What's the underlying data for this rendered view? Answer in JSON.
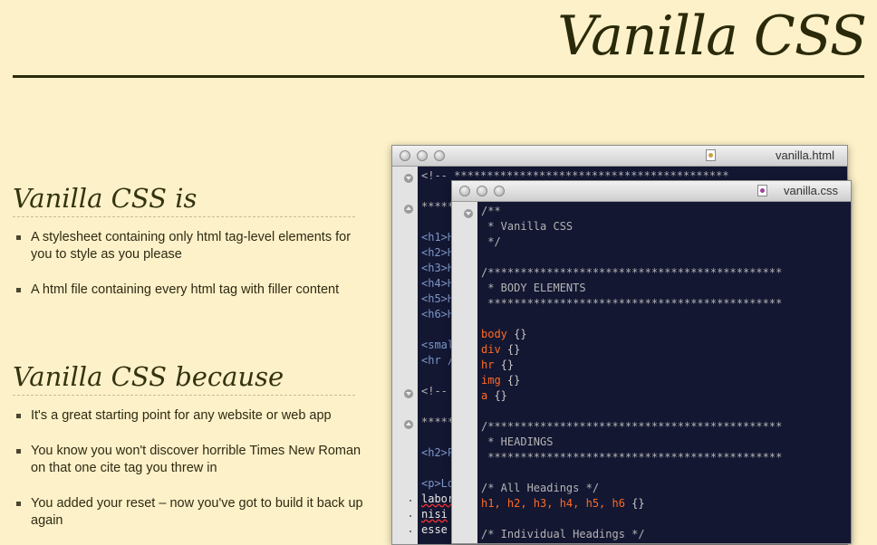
{
  "header": {
    "site_title": "Vanilla CSS"
  },
  "sections": [
    {
      "heading": "Vanilla CSS is",
      "items": [
        "A stylesheet containing only html tag-level elements for you to style as you please",
        "A html file containing every html tag with filler content"
      ]
    },
    {
      "heading": "Vanilla CSS because",
      "items": [
        "It's a great starting point for any website or web app",
        "You know you won't discover horrible Times New Roman on that one cite tag you threw in",
        "You added your reset – now you've got to build it back up again"
      ]
    }
  ],
  "html_window": {
    "title": "vanilla.html",
    "lines": [
      "<!-- ******************************************",
      "",
      "*****",
      "",
      "<h1>H",
      "<h2>H",
      "<h3>H",
      "<h4>H",
      "<h5>H",
      "<h6>H",
      "",
      "<smal",
      "<hr /",
      "",
      "<!--",
      "",
      "*****",
      "",
      "<h2>P",
      "",
      "<p>Lo",
      "labor",
      "nisi",
      "esse"
    ]
  },
  "css_window": {
    "title": "vanilla.css",
    "lines": [
      "/**",
      " * Vanilla CSS",
      " */",
      "",
      "/*********************************************",
      " * BODY ELEMENTS",
      " *********************************************",
      "",
      "body {}",
      "div {}",
      "hr {}",
      "img {}",
      "a {}",
      "",
      "/*********************************************",
      " * HEADINGS",
      " *********************************************",
      "",
      "/* All Headings */",
      "h1, h2, h3, h4, h5, h6 {}",
      "",
      "/* Individual Headings */"
    ]
  },
  "colors": {
    "background": "#fdf1c9",
    "heading": "#333310",
    "editor_bg": "#131732",
    "selector": "#ff6a24"
  }
}
